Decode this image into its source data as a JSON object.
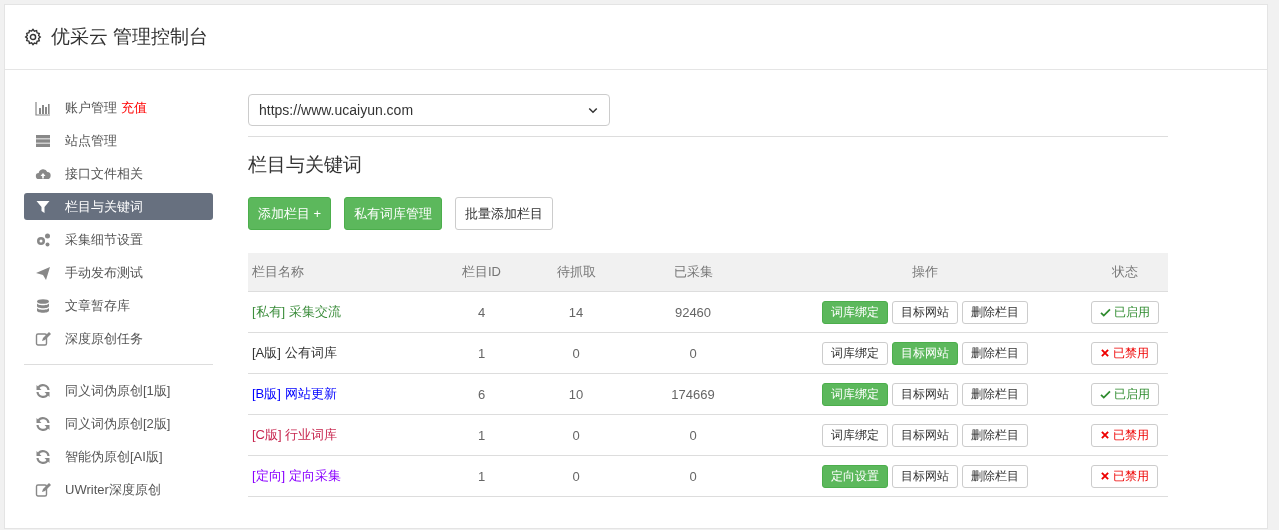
{
  "header": {
    "title": "优采云 管理控制台"
  },
  "sidebar": {
    "groups": [
      {
        "items": [
          {
            "label": "账户管理",
            "badge": "充值",
            "kind": "chart",
            "selected": false
          },
          {
            "label": "站点管理",
            "kind": "server",
            "selected": false
          },
          {
            "label": "接口文件相关",
            "kind": "cloud",
            "selected": false
          },
          {
            "label": "栏目与关键词",
            "kind": "filter",
            "selected": true
          },
          {
            "label": "采集细节设置",
            "kind": "gears",
            "selected": false
          },
          {
            "label": "手动发布测试",
            "kind": "send",
            "selected": false
          },
          {
            "label": "文章暂存库",
            "kind": "database",
            "selected": false
          },
          {
            "label": "深度原创任务",
            "kind": "edit",
            "selected": false
          }
        ]
      },
      {
        "items": [
          {
            "label": "同义词伪原创[1版]",
            "kind": "refresh",
            "selected": false
          },
          {
            "label": "同义词伪原创[2版]",
            "kind": "refresh",
            "selected": false
          },
          {
            "label": "智能伪原创[AI版]",
            "kind": "refresh",
            "selected": false
          },
          {
            "label": "UWriter深度原创",
            "kind": "edit",
            "selected": false
          }
        ]
      }
    ]
  },
  "site_select": {
    "value": "https://www.ucaiyun.com"
  },
  "section": {
    "title": "栏目与关键词",
    "buttons": [
      {
        "label": "添加栏目 +",
        "kind": "primary"
      },
      {
        "label": "私有词库管理",
        "kind": "primary"
      },
      {
        "label": "批量添加栏目",
        "kind": "default"
      }
    ]
  },
  "table": {
    "columns": [
      "栏目名称",
      "栏目ID",
      "待抓取",
      "已采集",
      "操作",
      "状态"
    ],
    "rows": [
      {
        "tag": "[私有]",
        "name": "采集交流",
        "color": "#3c8d3c",
        "id": "4",
        "pending": "14",
        "collected": "92460",
        "actions": [
          {
            "label": "词库绑定",
            "kind": "primary"
          },
          {
            "label": "目标网站",
            "kind": "default"
          },
          {
            "label": "删除栏目",
            "kind": "default"
          }
        ],
        "status": "已启用",
        "enabled": true
      },
      {
        "tag": "[A版]",
        "name": "公有词库",
        "color": "#333333",
        "id": "1",
        "pending": "0",
        "collected": "0",
        "actions": [
          {
            "label": "词库绑定",
            "kind": "default"
          },
          {
            "label": "目标网站",
            "kind": "primary"
          },
          {
            "label": "删除栏目",
            "kind": "default"
          }
        ],
        "status": "已禁用",
        "enabled": false
      },
      {
        "tag": "[B版]",
        "name": "网站更新",
        "color": "#0000ff",
        "id": "6",
        "pending": "10",
        "collected": "174669",
        "actions": [
          {
            "label": "词库绑定",
            "kind": "primary"
          },
          {
            "label": "目标网站",
            "kind": "default"
          },
          {
            "label": "删除栏目",
            "kind": "default"
          }
        ],
        "status": "已启用",
        "enabled": true
      },
      {
        "tag": "[C版]",
        "name": "行业词库",
        "color": "#c7254e",
        "id": "1",
        "pending": "0",
        "collected": "0",
        "actions": [
          {
            "label": "词库绑定",
            "kind": "default"
          },
          {
            "label": "目标网站",
            "kind": "default"
          },
          {
            "label": "删除栏目",
            "kind": "default"
          }
        ],
        "status": "已禁用",
        "enabled": false
      },
      {
        "tag": "[定向]",
        "name": "定向采集",
        "color": "#8a00ff",
        "id": "1",
        "pending": "0",
        "collected": "0",
        "actions": [
          {
            "label": "定向设置",
            "kind": "primary"
          },
          {
            "label": "目标网站",
            "kind": "default"
          },
          {
            "label": "删除栏目",
            "kind": "default"
          }
        ],
        "status": "已禁用",
        "enabled": false
      }
    ]
  }
}
